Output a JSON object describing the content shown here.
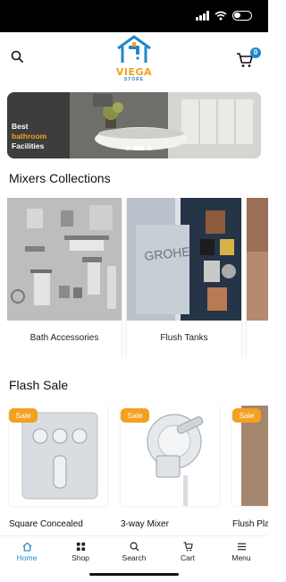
{
  "header": {
    "logo_text": "VIEGA",
    "logo_sub": "STORE",
    "cart_count": "0",
    "icons": {
      "search": "search-icon",
      "cart": "cart-icon"
    }
  },
  "banner": {
    "line1": "Best",
    "line2": "bathroom",
    "line3": "Facilities",
    "slides": 3,
    "active_slide": 1
  },
  "collections": {
    "title": "Mixers Collections",
    "items": [
      {
        "label": "Bath Accessories"
      },
      {
        "label": "Flush Tanks"
      },
      {
        "label": ""
      }
    ]
  },
  "flash_sale": {
    "title": "Flash Sale",
    "badge": "Sale",
    "products": [
      {
        "name": "Square Concealed"
      },
      {
        "name": "3-way Mixer"
      },
      {
        "name": "Flush Pla"
      }
    ]
  },
  "bottom_nav": {
    "items": [
      {
        "label": "Home",
        "icon": "home-icon"
      },
      {
        "label": "Shop",
        "icon": "grid-icon"
      },
      {
        "label": "Search",
        "icon": "search-icon"
      },
      {
        "label": "Cart",
        "icon": "cart-icon"
      },
      {
        "label": "Menu",
        "icon": "menu-icon"
      }
    ]
  },
  "colors": {
    "accent": "#f4a020",
    "brand": "#1e88c8"
  }
}
